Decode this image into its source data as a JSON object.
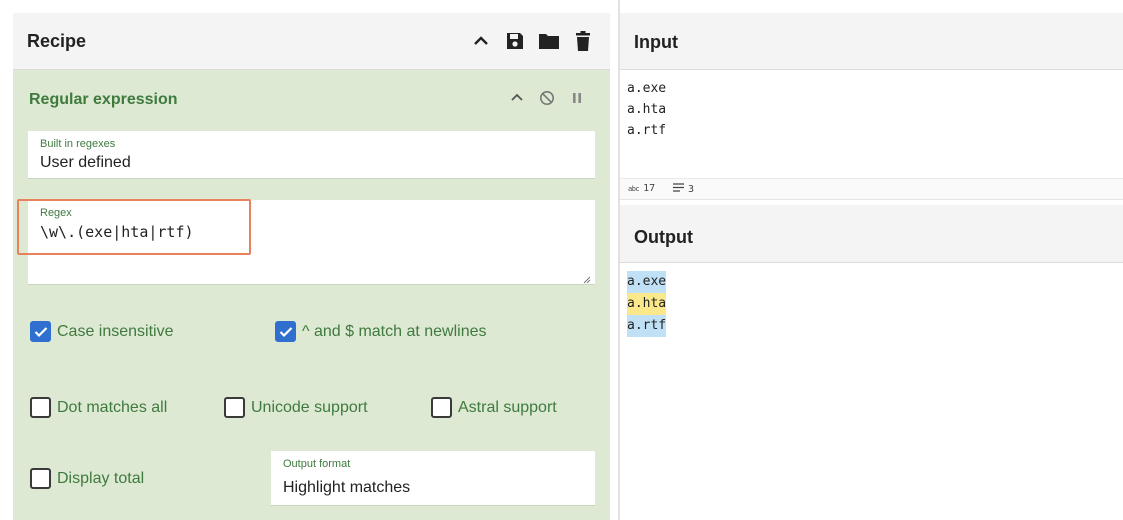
{
  "recipe": {
    "title": "Recipe",
    "icons": [
      "chevron-up-icon",
      "save-icon",
      "folder-icon",
      "trash-icon"
    ]
  },
  "operation": {
    "title": "Regular expression",
    "icons": [
      "chevron-up-icon",
      "disable-icon",
      "pause-icon"
    ],
    "built_in": {
      "label": "Built in regexes",
      "value": "User defined"
    },
    "regex": {
      "label": "Regex",
      "value": "\\w\\.(exe|hta|rtf)"
    },
    "checkboxes": [
      {
        "label": "Case insensitive",
        "checked": true
      },
      {
        "label": "^ and $ match at newlines",
        "checked": true
      },
      {
        "label": "Dot matches all",
        "checked": false
      },
      {
        "label": "Unicode support",
        "checked": false
      },
      {
        "label": "Astral support",
        "checked": false
      },
      {
        "label": "Display total",
        "checked": false
      }
    ],
    "output_format": {
      "label": "Output format",
      "value": "Highlight matches"
    }
  },
  "input": {
    "title": "Input",
    "lines": [
      "a.exe",
      "a.hta",
      "a.rtf"
    ],
    "status": {
      "chars": "17",
      "lines": "3"
    }
  },
  "output": {
    "title": "Output",
    "lines": [
      "a.exe",
      "a.hta",
      "a.rtf"
    ]
  },
  "colors": {
    "accent_green": "#3f7a3f",
    "recipe_bg": "#dde9d2",
    "highlight_border": "#e8825c",
    "checkbox_blue": "#2f6fcf",
    "match_blue": "#bfe0f5",
    "match_yellow": "#fbe88a"
  }
}
